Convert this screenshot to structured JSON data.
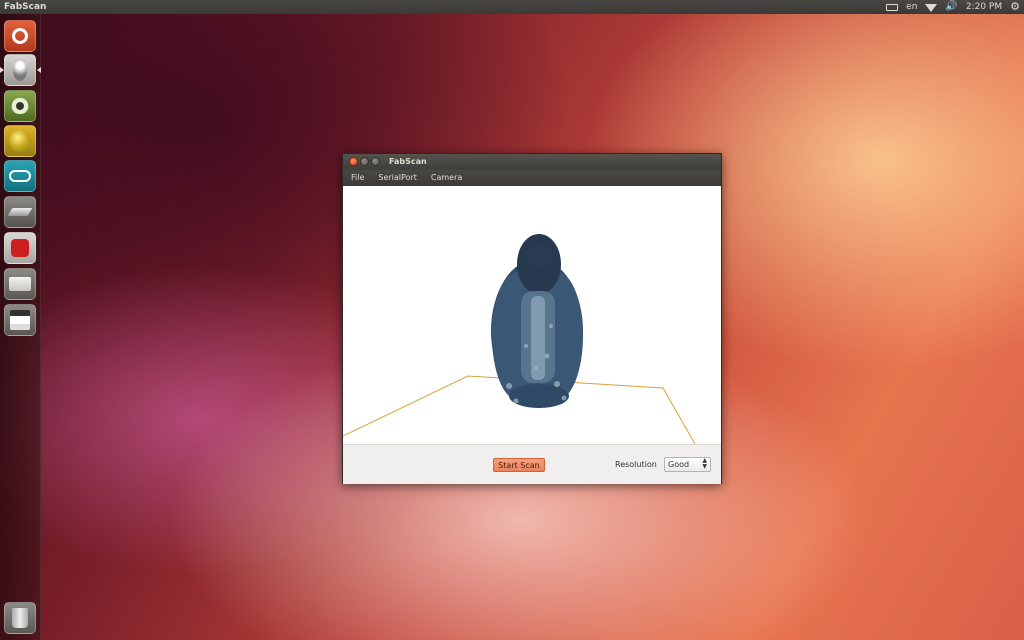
{
  "top_panel": {
    "app_title": "FabScan",
    "language": "en",
    "time": "2:20 PM",
    "icons": [
      "keyboard-icon",
      "wifi-icon",
      "volume-icon",
      "settings-gear-icon"
    ]
  },
  "launcher": {
    "items": [
      {
        "name": "ubuntu-dash",
        "icon": "ubuntu-logo-icon",
        "color": "#d24b2c"
      },
      {
        "name": "fabscan",
        "icon": "penguin-icon",
        "color": "#b9b6b0"
      },
      {
        "name": "meshlab",
        "icon": "eye-icon",
        "color": "#6b8a3a"
      },
      {
        "name": "blender",
        "icon": "3d-sphere-icon",
        "color": "#c9a317"
      },
      {
        "name": "arduino",
        "icon": "arduino-infinity-icon",
        "color": "#1c8a9a"
      },
      {
        "name": "slicer",
        "icon": "printer-plate-icon",
        "color": "#7a7872"
      },
      {
        "name": "repetier",
        "icon": "r-badge-icon",
        "color": "#cc1f1f"
      },
      {
        "name": "drive",
        "icon": "drive-icon",
        "color": "#d9d7d3"
      },
      {
        "name": "floppy",
        "icon": "floppy-icon",
        "color": "#e8e6e2"
      }
    ],
    "trash_icon": "trash-icon"
  },
  "window": {
    "title": "FabScan",
    "menu": [
      "File",
      "SerialPort",
      "Camera"
    ],
    "start_scan_label": "Start Scan",
    "resolution_label": "Resolution",
    "resolution_value": "Good"
  },
  "colors": {
    "accent": "#e9825a",
    "grid_line": "#d9a13b",
    "point_cloud": "#2e4a66"
  }
}
